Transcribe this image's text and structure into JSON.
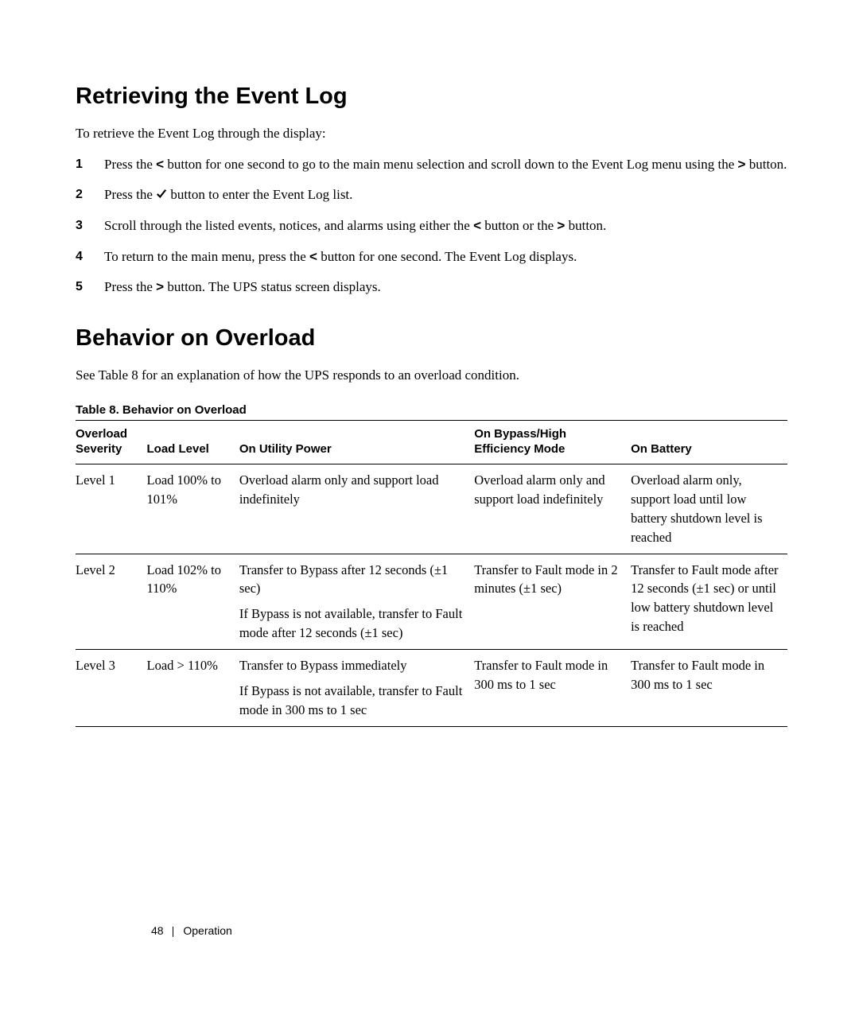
{
  "section1": {
    "heading": "Retrieving the Event Log",
    "intro": "To retrieve the Event Log through the display:",
    "steps": {
      "s1a": "Press the ",
      "s1b": "<",
      "s1c": " button for one second to go to the main menu selection and scroll down to the Event Log menu using the ",
      "s1d": ">",
      "s1e": " button.",
      "s2a": "Press the ",
      "s2c": " button to enter the Event Log list.",
      "s3a": "Scroll through the listed events, notices, and alarms using either the ",
      "s3b": "<",
      "s3c": " button or the ",
      "s3d": ">",
      "s3e": " button.",
      "s4a": "To return to the main menu, press the ",
      "s4b": "<",
      "s4c": " button for one second. The Event Log displays.",
      "s5a": "Press the ",
      "s5b": ">",
      "s5c": " button. The UPS status screen displays."
    }
  },
  "section2": {
    "heading": "Behavior on Overload",
    "intro": "See Table 8 for an explanation of how the UPS responds to an overload condition.",
    "table_caption": "Table 8. Behavior on Overload",
    "headers": {
      "h1a": "Overload",
      "h1b": "Severity",
      "h2": "Load Level",
      "h3": "On Utility Power",
      "h4a": "On Bypass/High",
      "h4b": "Efficiency Mode",
      "h5": "On Battery"
    },
    "rows": {
      "r1": {
        "c1": "Level 1",
        "c2": "Load 100% to 101%",
        "c3": "Overload alarm only and support load indefinitely",
        "c4": "Overload alarm only and support load indefinitely",
        "c5": "Overload alarm only, support load until low battery shutdown level is reached"
      },
      "r2": {
        "c1": "Level 2",
        "c2": "Load 102% to 110%",
        "c3a": "Transfer to Bypass after 12 seconds (±1 sec)",
        "c3b": "If Bypass is not available, transfer to Fault mode after 12 seconds (±1 sec)",
        "c4": "Transfer to Fault mode in 2 minutes (±1 sec)",
        "c5": "Transfer to Fault mode after 12 seconds (±1 sec) or until low battery shutdown level is reached"
      },
      "r3": {
        "c1": "Level 3",
        "c2": "Load > 110%",
        "c3a": "Transfer to Bypass immediately",
        "c3b": "If Bypass is not available, transfer to Fault mode in 300 ms to 1 sec",
        "c4": "Transfer to Fault mode in 300 ms to 1 sec",
        "c5": "Transfer to Fault mode in 300 ms to 1 sec"
      }
    }
  },
  "footer": {
    "page": "48",
    "label": "Operation"
  }
}
